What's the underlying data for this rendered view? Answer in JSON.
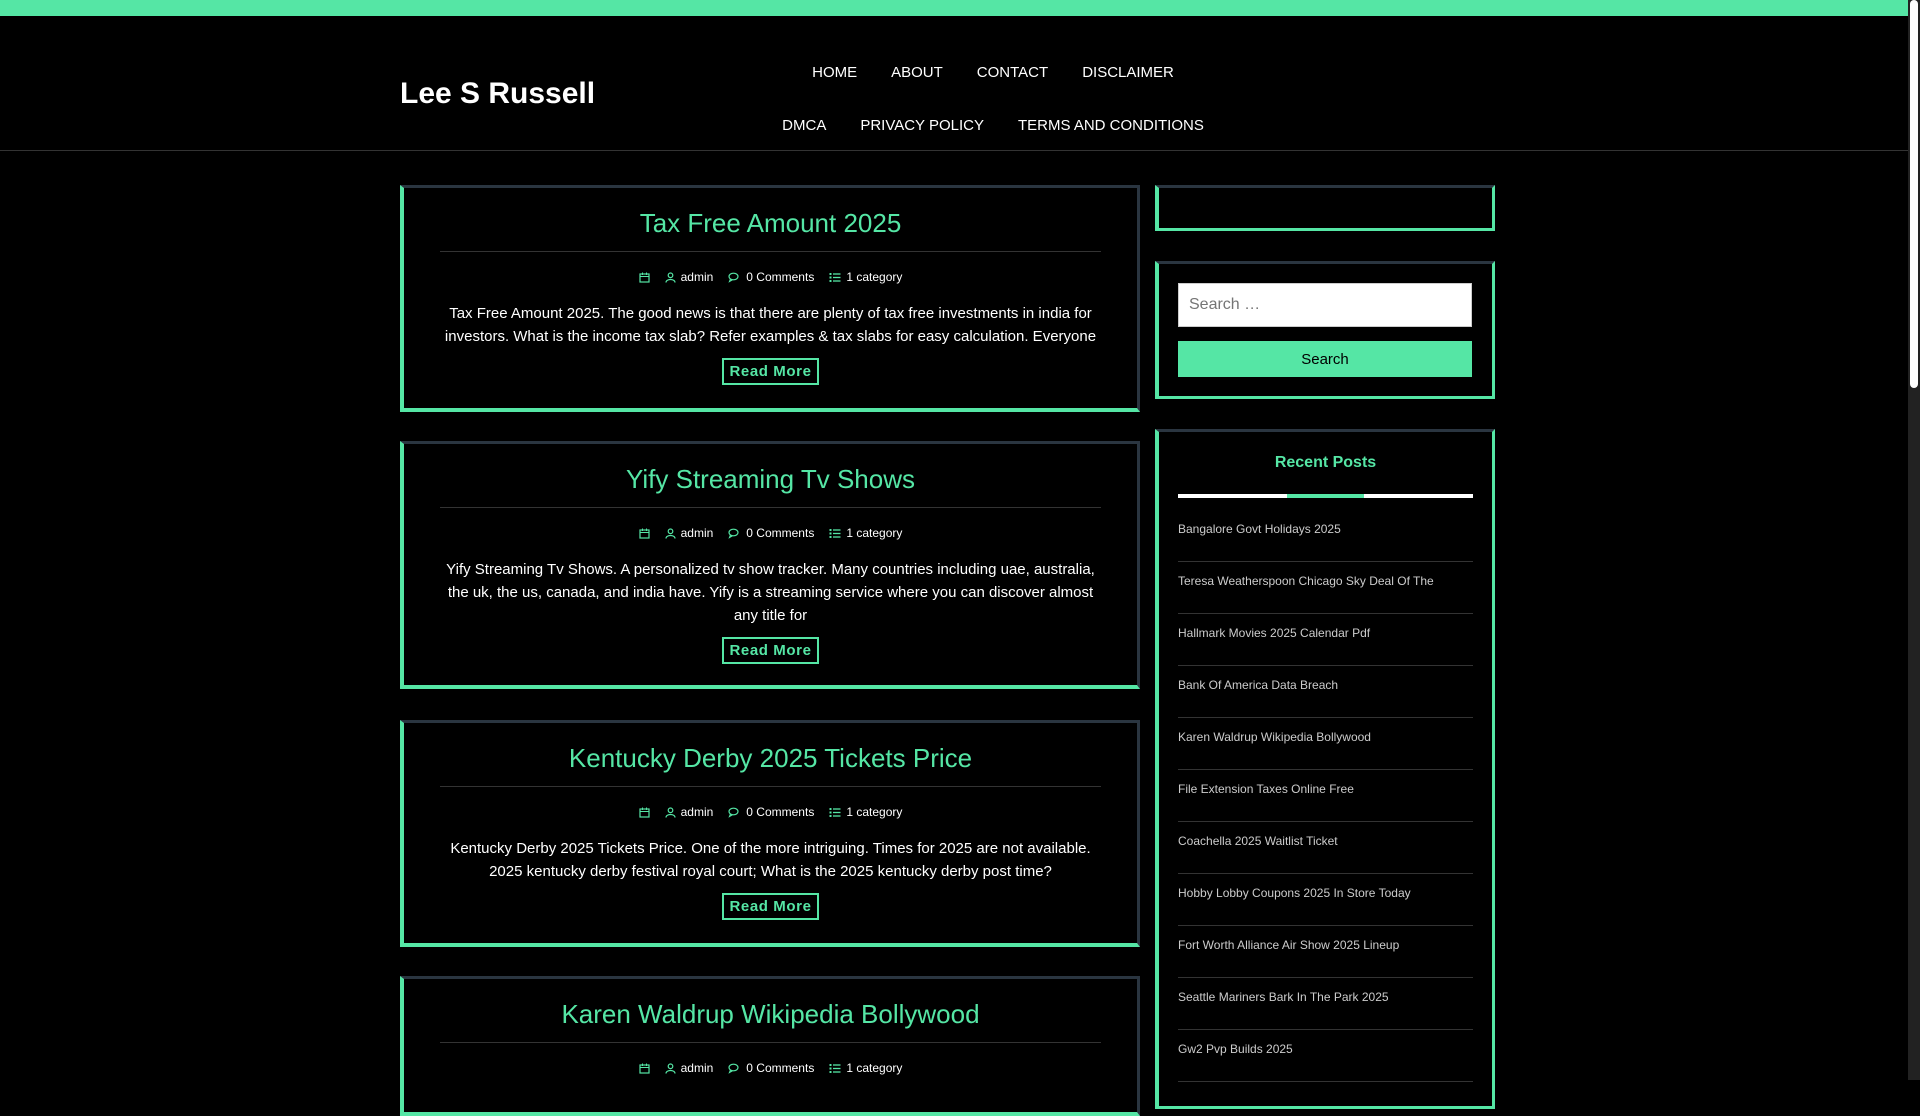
{
  "site": {
    "title": "Lee S Russell"
  },
  "nav": [
    "HOME",
    "ABOUT",
    "CONTACT",
    "DISCLAIMER",
    "DMCA",
    "PRIVACY POLICY",
    "TERMS AND CONDITIONS"
  ],
  "posts": [
    {
      "title": "Tax Free Amount 2025",
      "author": "admin",
      "comments": "0 Comments",
      "category": "1 category",
      "excerpt": "Tax Free Amount 2025. The good news is that there are plenty of tax free investments in india for investors. What is the income tax slab? Refer examples & tax slabs for easy calculation. Everyone",
      "read_more": "Read More"
    },
    {
      "title": "Yify Streaming Tv Shows",
      "author": "admin",
      "comments": "0 Comments",
      "category": "1 category",
      "excerpt": "Yify Streaming Tv Shows. A personalized tv show tracker. Many countries including uae, australia, the uk, the us, canada, and india have. Yify is a streaming service where you can discover almost any title for",
      "read_more": "Read More"
    },
    {
      "title": "Kentucky Derby 2025 Tickets Price",
      "author": "admin",
      "comments": "0 Comments",
      "category": "1 category",
      "excerpt": "Kentucky Derby 2025 Tickets Price. One of the more intriguing. Times for 2025 are not available. 2025 kentucky derby festival royal court; What is the 2025 kentucky derby post time?",
      "read_more": "Read More"
    },
    {
      "title": "Karen Waldrup Wikipedia Bollywood",
      "author": "admin",
      "comments": "0 Comments",
      "category": "1 category"
    }
  ],
  "sidebar": {
    "search": {
      "placeholder": "Search …",
      "button": "Search"
    },
    "recent": {
      "title": "Recent Posts",
      "items": [
        "Bangalore Govt Holidays 2025",
        "Teresa Weatherspoon Chicago Sky Deal Of The",
        "Hallmark Movies 2025 Calendar Pdf",
        "Bank Of America Data Breach",
        "Karen Waldrup Wikipedia Bollywood",
        "File Extension Taxes Online Free",
        "Coachella 2025 Waitlist Ticket",
        "Hobby Lobby Coupons 2025 In Store Today",
        "Fort Worth Alliance Air Show 2025 Lineup",
        "Seattle Mariners Bark In The Park 2025",
        "Gw2 Pvp Builds 2025"
      ]
    }
  },
  "colors": {
    "accent": "#55e6a5",
    "background": "#000000"
  }
}
